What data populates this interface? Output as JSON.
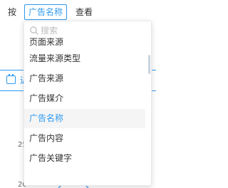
{
  "toolbar": {
    "prefix_label": "按",
    "selected_dimension": "广告名称",
    "suffix_label": "查看"
  },
  "background": {
    "date_fragment": "近",
    "y_ticks": [
      "25",
      "20"
    ]
  },
  "dropdown": {
    "search_placeholder": "搜索",
    "items": [
      {
        "label": "页面来源"
      },
      {
        "label": "流量来源类型"
      },
      {
        "label": "广告来源"
      },
      {
        "label": "广告媒介"
      },
      {
        "label": "广告名称"
      },
      {
        "label": "广告内容"
      },
      {
        "label": "广告关键字"
      }
    ],
    "selected_index": 4
  },
  "colors": {
    "accent": "#2f9af0",
    "text": "#333333",
    "placeholder": "#bfbfbf",
    "selected_bg": "#f5f5f5"
  }
}
